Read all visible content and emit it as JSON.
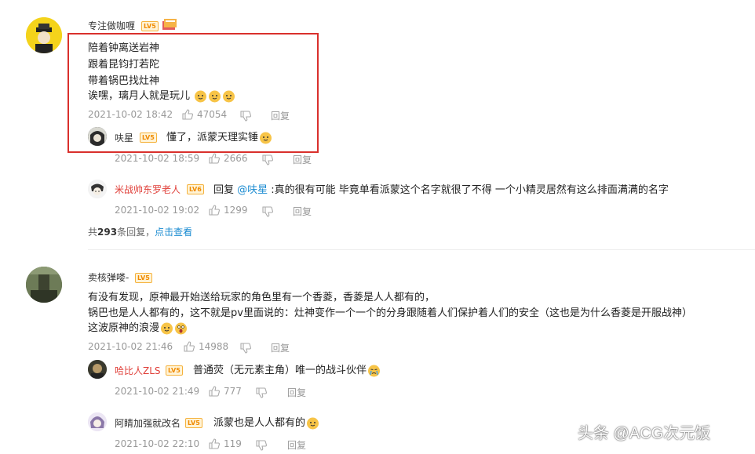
{
  "comments": [
    {
      "user": "专注做咖喱",
      "level": "LV5",
      "lines": [
        "陪着钟离送岩神",
        "跟着昆钧打若陀",
        "带着锅巴找灶神",
        "诶嘿，璃月人就是玩儿"
      ],
      "date": "2021-10-02 18:42",
      "likes": "47054",
      "reply_label": "回复",
      "replies": [
        {
          "user": "呋星",
          "level": "LV5",
          "text": "懂了，派蒙天理实锤",
          "date": "2021-10-02 18:59",
          "likes": "2666",
          "reply_label": "回复"
        },
        {
          "user": "米战帅东罗老人",
          "level": "LV6",
          "prefix": "回复 ",
          "mention": "@呋星",
          "text": " :真的很有可能 毕竟单看派蒙这个名字就很了不得 一个小精灵居然有这么排面满满的名字",
          "date": "2021-10-02 19:02",
          "likes": "1299",
          "reply_label": "回复"
        }
      ],
      "summary_prefix": "共",
      "summary_count": "293",
      "summary_suffix": "条回复，",
      "summary_link": "点击查看"
    },
    {
      "user": "卖核弹喽-",
      "level": "LV5",
      "lines": [
        "有没有发现，原神最开始送给玩家的角色里有一个香菱，香菱是人人都有的，",
        "锅巴也是人人都有的，这不就是pv里面说的：灶神变作一个一个的分身跟随着人们保护着人们的安全（这也是为什么香菱是开服战神）",
        "这波原神的浪漫"
      ],
      "date": "2021-10-02 21:46",
      "likes": "14988",
      "reply_label": "回复",
      "replies": [
        {
          "user": "哈比人ZLS",
          "level": "LV5",
          "text": "普通荧（无元素主角）唯一的战斗伙伴",
          "date": "2021-10-02 21:49",
          "likes": "777",
          "reply_label": "回复"
        },
        {
          "user": "阿睛加强就改名",
          "level": "LV5",
          "text": "派蒙也是人人都有的",
          "date": "2021-10-02 22:10",
          "likes": "119",
          "reply_label": "回复"
        }
      ]
    }
  ],
  "watermark": "头条 @ACG次元饭",
  "colors": {
    "highlight_box": "#d9302c",
    "link": "#1a8bd1",
    "red_name": "#e0403a",
    "meta": "#999999"
  }
}
